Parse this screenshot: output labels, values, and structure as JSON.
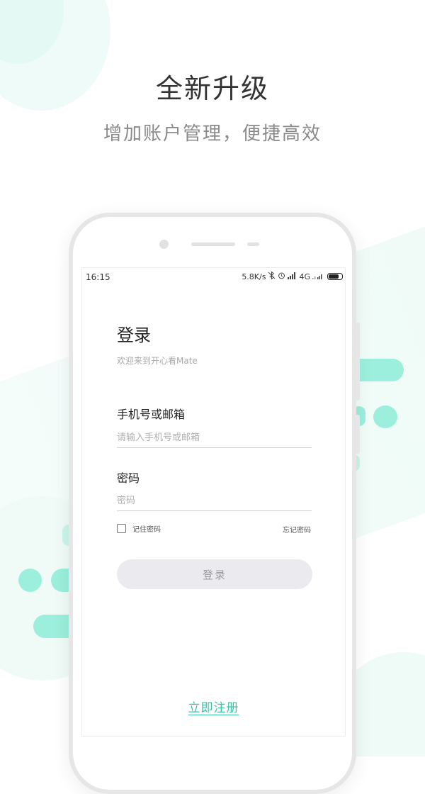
{
  "headline": "全新升级",
  "subline": "增加账户管理，便捷高效",
  "colors": {
    "accent": "#3cc4a8",
    "bubble": "#9befdc",
    "bubble_light": "#e7faf5"
  },
  "status_bar": {
    "time": "16:15",
    "speed": "5.8K/s",
    "network": "4G",
    "icons": [
      "bluetooth-off-icon",
      "alarm-icon",
      "signal-icon",
      "battery-icon"
    ],
    "battery_level": 0.8
  },
  "login": {
    "title": "登录",
    "welcome": "欢迎来到开心看Mate",
    "account_label": "手机号或邮箱",
    "account_placeholder": "请输入手机号或邮箱",
    "password_label": "密码",
    "password_placeholder": "密码",
    "remember_label": "记住密码",
    "forgot_label": "忘记密码",
    "login_button": "登录",
    "register_link": "立即注册"
  }
}
